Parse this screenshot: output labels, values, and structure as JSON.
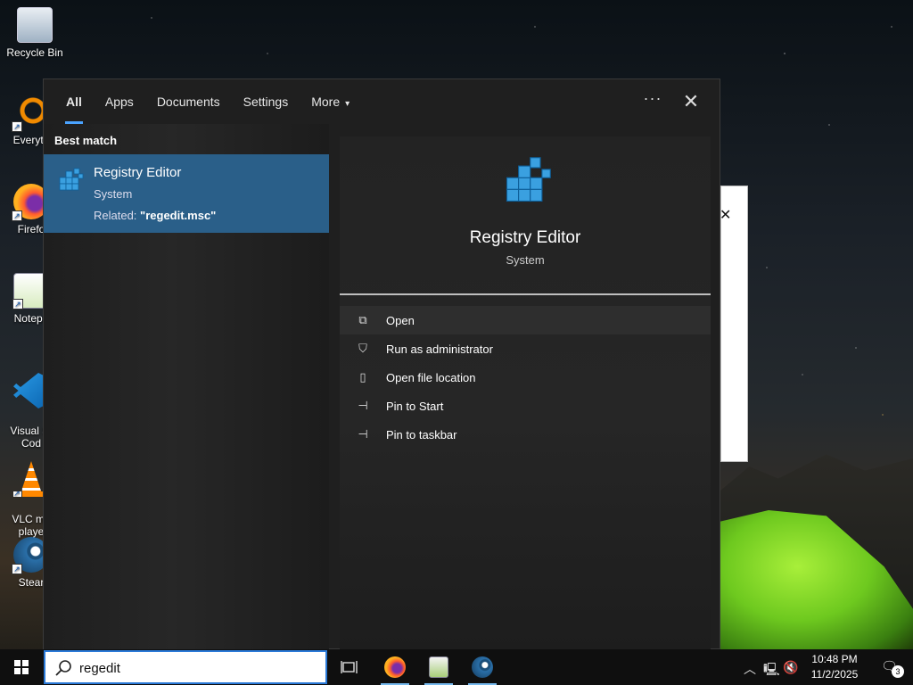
{
  "desktop": {
    "icons": [
      {
        "label": "Recycle Bin"
      },
      {
        "label": "Everyth"
      },
      {
        "label": "Firefo"
      },
      {
        "label": "Notepa"
      },
      {
        "label": "Visual St\nCod"
      },
      {
        "label": "VLC me\nplaye"
      },
      {
        "label": "Stear"
      }
    ]
  },
  "search": {
    "tabs": [
      {
        "label": "All",
        "active": true
      },
      {
        "label": "Apps"
      },
      {
        "label": "Documents"
      },
      {
        "label": "Settings"
      },
      {
        "label": "More"
      }
    ],
    "more_caret": "▾",
    "options_glyph": "···",
    "close_glyph": "✕",
    "best_match_heading": "Best match",
    "result": {
      "name": "Registry Editor",
      "type": "System",
      "related_prefix": "Related: ",
      "related_value": "\"regedit.msc\""
    },
    "detail": {
      "name": "Registry Editor",
      "type": "System",
      "actions": [
        {
          "label": "Open",
          "icon": "open-icon",
          "glyph": "⧉"
        },
        {
          "label": "Run as administrator",
          "icon": "shield-icon",
          "glyph": "⛉"
        },
        {
          "label": "Open file location",
          "icon": "folder-location-icon",
          "glyph": "▯"
        },
        {
          "label": "Pin to Start",
          "icon": "pin-icon",
          "glyph": "⊣"
        },
        {
          "label": "Pin to taskbar",
          "icon": "pin-icon",
          "glyph": "⊣"
        }
      ]
    },
    "query": "regedit"
  },
  "taskbar": {
    "pinned": [
      {
        "name": "task-view",
        "running": false
      },
      {
        "name": "firefox",
        "running": true
      },
      {
        "name": "notepad-plus-plus",
        "running": true
      },
      {
        "name": "steam",
        "running": true
      }
    ],
    "clock": {
      "time": "10:48 PM",
      "date": "11/2/2025"
    },
    "notification_count": "3"
  },
  "colors": {
    "accent": "#2b7ad8",
    "result_highlight": "#2a5f89",
    "panel_bg": "#1f1f1f"
  }
}
